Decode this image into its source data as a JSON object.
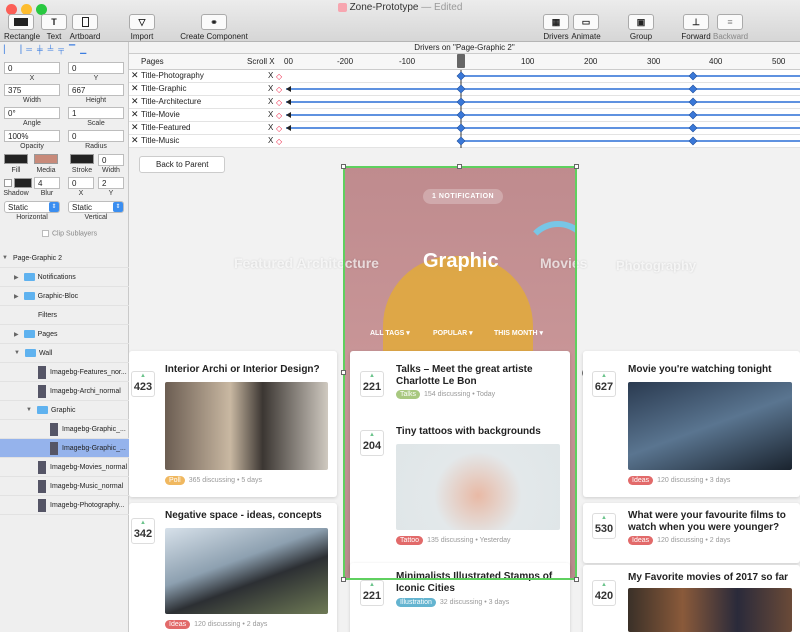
{
  "window": {
    "title": "Zone-Prototype",
    "status": "— Edited"
  },
  "toolbar": {
    "rectangle": "Rectangle",
    "text": "Text",
    "artboard": "Artboard",
    "import": "Import",
    "create_component": "Create Component",
    "drivers": "Drivers",
    "animate": "Animate",
    "group": "Group",
    "forward": "Forward",
    "backward": "Backward"
  },
  "props": {
    "x": "0",
    "y": "0",
    "x_label": "X",
    "y_label": "Y",
    "width": "375",
    "height": "667",
    "width_label": "Width",
    "height_label": "Height",
    "angle": "0°",
    "scale": "1",
    "angle_label": "Angle",
    "scale_label": "Scale",
    "opacity": "100%",
    "radius": "0",
    "opacity_label": "Opacity",
    "radius_label": "Radius",
    "fill_label": "Fill",
    "media_label": "Media",
    "stroke_label": "Stroke",
    "stroke_width": "0",
    "stroke_width_label": "Width",
    "shadow_label": "Shadow",
    "blur": "4",
    "blur_label": "Blur",
    "shx": "0",
    "shy": "2",
    "shx_label": "X",
    "shy_label": "Y",
    "horizontal": "Static",
    "vertical": "Static",
    "horizontal_label": "Horizontal",
    "vertical_label": "Vertical",
    "clip_label": "Clip Sublayers"
  },
  "layers": [
    {
      "label": "Page-Graphic 2",
      "indent": 2,
      "kind": "expanded"
    },
    {
      "label": "Notifications",
      "indent": 14,
      "kind": "folder"
    },
    {
      "label": "Graphic-Bloc",
      "indent": 14,
      "kind": "folder"
    },
    {
      "label": "Filters",
      "indent": 38,
      "kind": "plain"
    },
    {
      "label": "Pages",
      "indent": 14,
      "kind": "folder"
    },
    {
      "label": "Wall",
      "indent": 14,
      "kind": "folder-open"
    },
    {
      "label": "Imagebg-Features_nor...",
      "indent": 38,
      "kind": "thumb"
    },
    {
      "label": "Imagebg-Archi_normal",
      "indent": 38,
      "kind": "thumb"
    },
    {
      "label": "Graphic",
      "indent": 26,
      "kind": "folder-open"
    },
    {
      "label": "Imagebg-Graphic_...",
      "indent": 50,
      "kind": "thumb"
    },
    {
      "label": "Imagebg-Graphic_...",
      "indent": 50,
      "kind": "thumb-sel"
    },
    {
      "label": "Imagebg-Movies_normal",
      "indent": 38,
      "kind": "thumb"
    },
    {
      "label": "Imagebg-Music_normal",
      "indent": 38,
      "kind": "thumb"
    },
    {
      "label": "Imagebg-Photography...",
      "indent": 38,
      "kind": "thumb"
    }
  ],
  "timeline": {
    "drivers_label": "Drivers on \"Page-Graphic 2\"",
    "pages_label": "Pages",
    "scroll_label": "Scroll X",
    "ticks": [
      "00",
      "-200",
      "-100",
      "0",
      "100",
      "200",
      "300",
      "400",
      "500"
    ],
    "rows": [
      "Title-Photography",
      "Title-Graphic",
      "Title-Architecture",
      "Title-Movie",
      "Title-Featured",
      "Title-Music"
    ],
    "row_x": "X"
  },
  "canvas": {
    "back_button": "Back to Parent",
    "notification": "1 NOTIFICATION",
    "hero_title": "Graphic",
    "ghost_left": "Featured  Architecture",
    "ghost_right1": "Movies",
    "ghost_right2": "Photography",
    "filters": [
      "ALL TAGS",
      "POPULAR",
      "THIS MONTH"
    ],
    "cards": [
      {
        "votes": "423",
        "title": "Interior Archi or Interior Design?",
        "tag": "Poll",
        "tag_color": "#f0b860",
        "discussing": "365 discussing",
        "time": "5 days"
      },
      {
        "votes": "342",
        "title": "Negative space - ideas, concepts",
        "tag": "Ideas",
        "tag_color": "#e26a6a",
        "discussing": "120 discussing",
        "time": "2 days"
      },
      {
        "votes": "221",
        "title": "Talks – Meet the great artiste Charlotte Le Bon",
        "tag": "Talks",
        "tag_color": "#a8c880",
        "discussing": "154 discussing",
        "time": "Today"
      },
      {
        "votes": "204",
        "title": "Tiny tattoos with backgrounds",
        "tag": "Tattoo",
        "tag_color": "#e26a6a",
        "discussing": "135 discussing",
        "time": "Yesterday"
      },
      {
        "votes": "221",
        "title": "Minimalists Illustrated Stamps of Iconic Cities",
        "tag": "Illustration",
        "tag_color": "#64b4d0",
        "discussing": "32 discussing",
        "time": "3 days"
      },
      {
        "votes": "627",
        "title": "Movie you're watching tonight",
        "tag": "Ideas",
        "tag_color": "#e26a6a",
        "discussing": "120 discussing",
        "time": "3 days"
      },
      {
        "votes": "530",
        "title": "What were your favourite films to watch when you were younger?",
        "tag": "Ideas",
        "tag_color": "#e26a6a",
        "discussing": "120 discussing",
        "time": "2 days"
      },
      {
        "votes": "420",
        "title": "My Favorite movies of 2017 so far",
        "tag": "",
        "tag_color": "",
        "discussing": "",
        "time": ""
      }
    ]
  }
}
